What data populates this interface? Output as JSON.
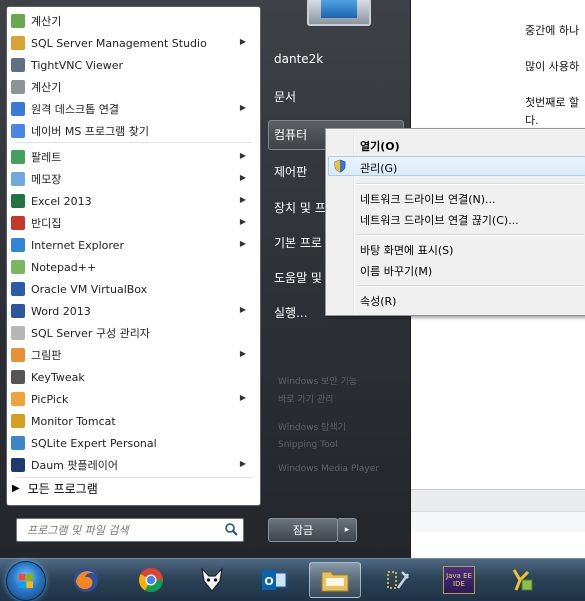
{
  "document": {
    "lines": [
      "중간에 하나",
      "많이 사용하",
      "첫번째로 할",
      "다."
    ]
  },
  "programs": [
    {
      "label": "계산기",
      "arrow": false,
      "color": "#6aa84f"
    },
    {
      "label": "SQL Server Management Studio",
      "arrow": true,
      "color": "#d9a334"
    },
    {
      "label": "TightVNC Viewer",
      "arrow": false,
      "color": "#5f6f84"
    },
    {
      "label": "계산기",
      "arrow": false,
      "color": "#8c9399"
    },
    {
      "label": "원격 데스크톱 연결",
      "arrow": true,
      "color": "#3c78d8"
    },
    {
      "label": "네이버 MS 프로그램 찾기",
      "arrow": false,
      "color": "#4a86e8"
    },
    {
      "label": "팔레트",
      "arrow": true,
      "color": "#45a05d"
    },
    {
      "label": "메모장",
      "arrow": true,
      "color": "#6fa8dc"
    },
    {
      "label": "Excel 2013",
      "arrow": true,
      "color": "#217346"
    },
    {
      "label": "반디집",
      "arrow": true,
      "color": "#c0392b"
    },
    {
      "label": "Internet Explorer",
      "arrow": true,
      "color": "#2f86d8"
    },
    {
      "label": "Notepad++",
      "arrow": false,
      "color": "#7bb661"
    },
    {
      "label": "Oracle VM VirtualBox",
      "arrow": false,
      "color": "#2a5da8"
    },
    {
      "label": "Word 2013",
      "arrow": true,
      "color": "#2b579a"
    },
    {
      "label": "SQL Server 구성 관리자",
      "arrow": false,
      "color": "#b7b7b7"
    },
    {
      "label": "그림판",
      "arrow": true,
      "color": "#e69138"
    },
    {
      "label": "KeyTweak",
      "arrow": false,
      "color": "#555555"
    },
    {
      "label": "PicPick",
      "arrow": true,
      "color": "#f1a33b"
    },
    {
      "label": "Monitor Tomcat",
      "arrow": false,
      "color": "#d5a021"
    },
    {
      "label": "SQLite Expert Personal",
      "arrow": false,
      "color": "#3d85c6"
    },
    {
      "label": "Daum 팟플레이어",
      "arrow": true,
      "color": "#1d3b6e"
    }
  ],
  "all_programs_label": "모든 프로그램",
  "search": {
    "placeholder": "프로그램 및 파일 검색"
  },
  "right_links": {
    "user": "dante2k",
    "documents": "문서",
    "computer": "컴퓨터",
    "control_panel": "제어판",
    "devices": "장치 및 프",
    "default_programs": "기본 프로",
    "help": "도움말 및",
    "run": "실행..."
  },
  "faded_items": [
    "Windows 보안 기능",
    "바로 가기 관리",
    "Windows 탐색기",
    "Snipping Tool",
    "Windows Media Player"
  ],
  "shutdown": {
    "label": "잠금",
    "arrow": "▸"
  },
  "context_menu": {
    "open": "열기(O)",
    "manage": "관리(G)",
    "map_drive": "네트워크 드라이브 연결(N)...",
    "disconnect_drive": "네트워크 드라이브 연결 끊기(C)...",
    "show_desktop": "바탕 화면에 표시(S)",
    "rename": "이름 바꾸기(M)",
    "properties": "속성(R)"
  },
  "taskbar": {
    "apps": [
      {
        "name": "firefox",
        "label": ""
      },
      {
        "name": "chrome",
        "label": ""
      },
      {
        "name": "fox",
        "label": ""
      },
      {
        "name": "outlook",
        "label": "O"
      },
      {
        "name": "explorer",
        "label": ""
      },
      {
        "name": "tools",
        "label": ""
      },
      {
        "name": "java-ee",
        "label": "Java EE IDE"
      },
      {
        "name": "puzzle",
        "label": ""
      }
    ]
  }
}
